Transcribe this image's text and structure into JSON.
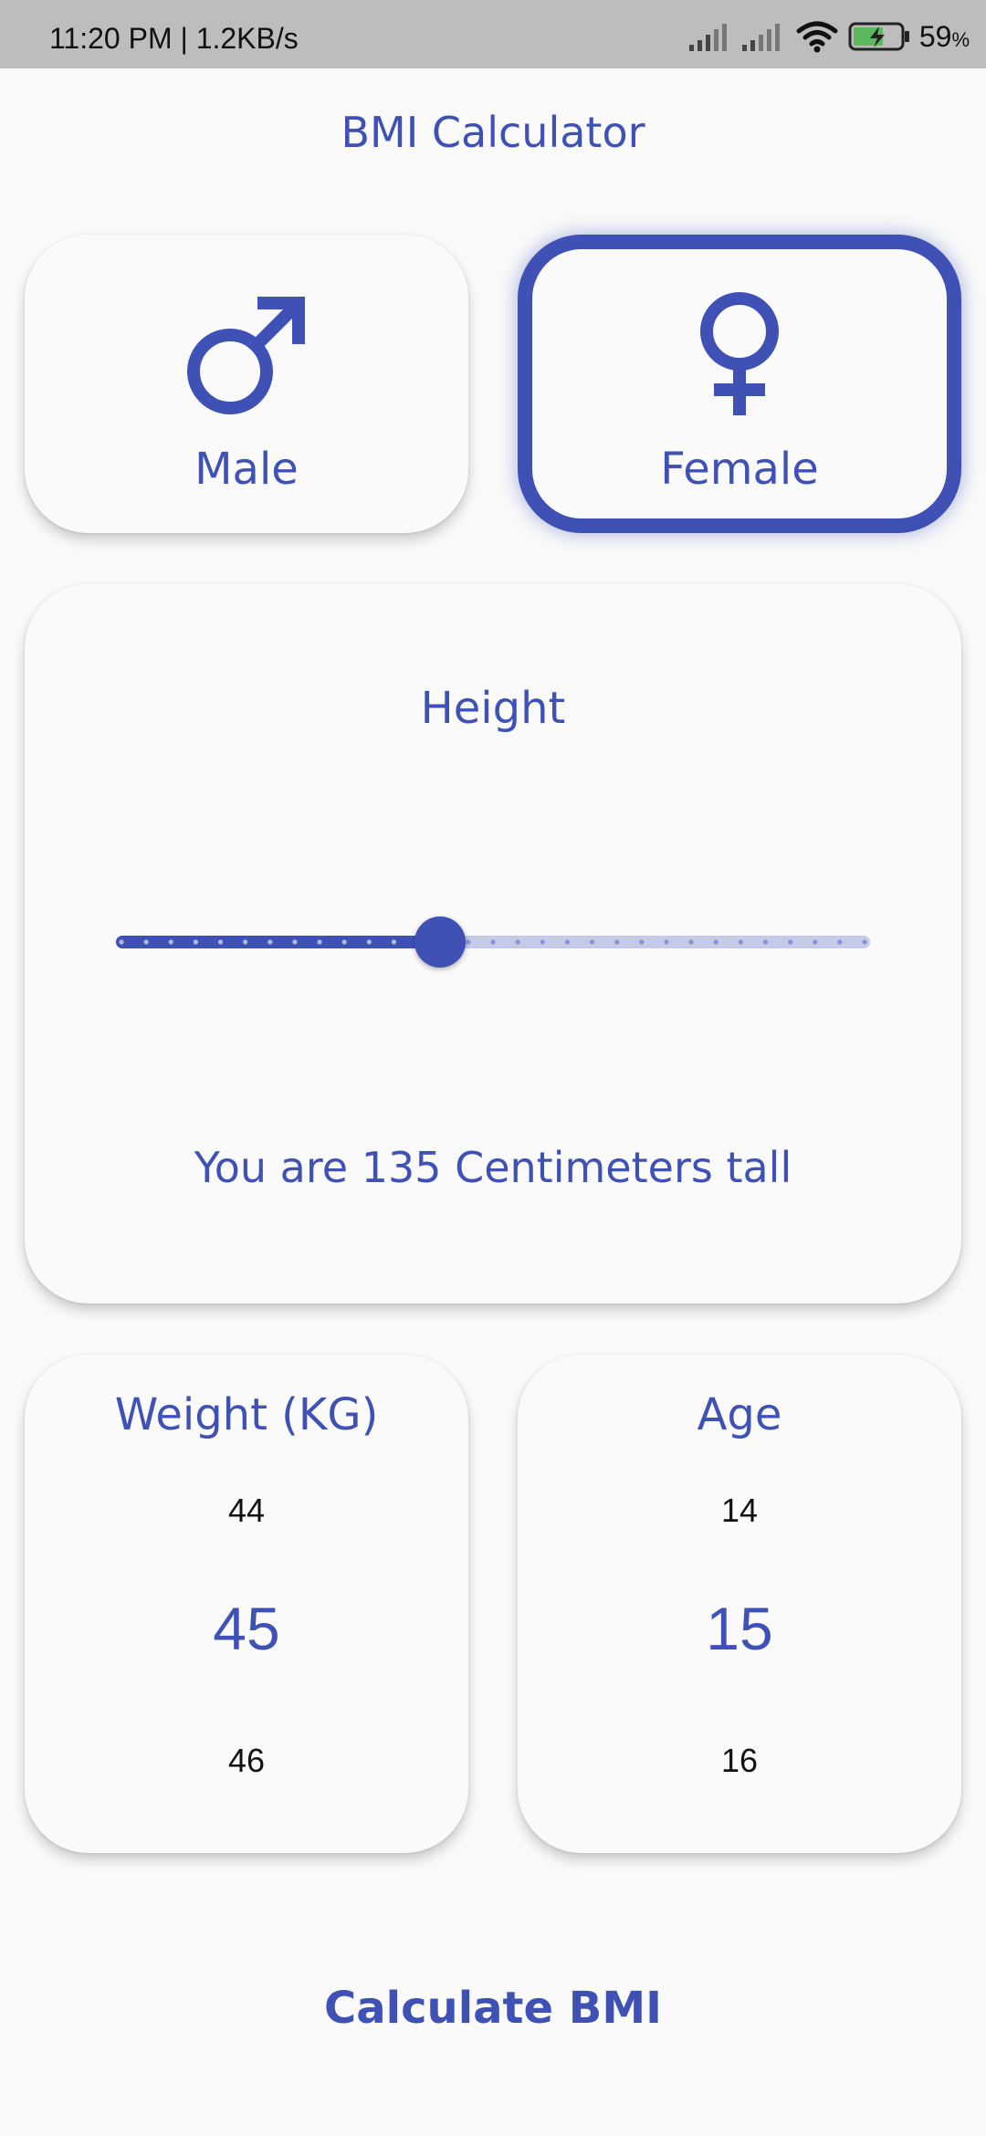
{
  "status_bar": {
    "time_speed": "11:20 PM | 1.2KB/s",
    "battery_percent": "59",
    "battery_unit": "%"
  },
  "app": {
    "title": "BMI Calculator"
  },
  "gender": {
    "male_label": "Male",
    "female_label": "Female",
    "selected": "female"
  },
  "height": {
    "title": "Height",
    "value": 135,
    "caption": "You are 135 Centimeters tall",
    "slider_fraction": 0.43
  },
  "weight": {
    "title": "Weight (KG)",
    "prev": "44",
    "current": "45",
    "next": "46"
  },
  "age": {
    "title": "Age",
    "prev": "14",
    "current": "15",
    "next": "16"
  },
  "actions": {
    "calculate_label": "Calculate BMI"
  },
  "colors": {
    "accent": "#3f51b5",
    "accent_light": "#c5cae9",
    "background": "#fafafa",
    "status_bar": "#bdbdbd"
  }
}
